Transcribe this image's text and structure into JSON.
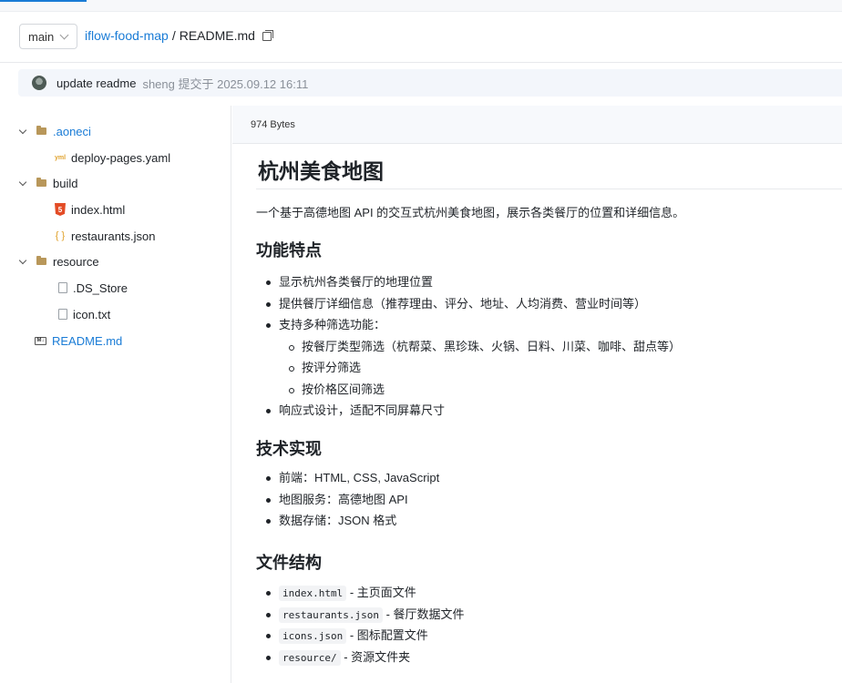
{
  "header": {
    "branch": "main",
    "repo": "iflow-food-map",
    "separator": "/",
    "file": "README.md"
  },
  "commit": {
    "message": "update readme",
    "meta": "sheng 提交于 2025.09.12 16:11"
  },
  "tree": {
    "aoneci": ".aoneci",
    "deploy": "deploy-pages.yaml",
    "build": "build",
    "index": "index.html",
    "restaurants": "restaurants.json",
    "resource": "resource",
    "ds_store": ".DS_Store",
    "icon_txt": "icon.txt",
    "readme": "README.md"
  },
  "file_size": "974 Bytes",
  "readme": {
    "title": "杭州美食地图",
    "intro": "一个基于高德地图 API 的交互式杭州美食地图，展示各类餐厅的位置和详细信息。",
    "features_heading": "功能特点",
    "features": [
      "显示杭州各类餐厅的地理位置",
      "提供餐厅详细信息（推荐理由、评分、地址、人均消费、营业时间等）",
      "支持多种筛选功能：",
      "按餐厅类型筛选（杭帮菜、黑珍珠、火锅、日料、川菜、咖啡、甜点等）",
      "按评分筛选",
      "按价格区间筛选",
      "响应式设计，适配不同屏幕尺寸"
    ],
    "tech_heading": "技术实现",
    "tech": [
      "前端：HTML, CSS, JavaScript",
      "地图服务：高德地图 API",
      "数据存储：JSON 格式"
    ],
    "structure_heading": "文件结构",
    "structure": [
      {
        "code": "index.html",
        "desc": " - 主页面文件"
      },
      {
        "code": "restaurants.json",
        "desc": " - 餐厅数据文件"
      },
      {
        "code": "icons.json",
        "desc": " - 图标配置文件"
      },
      {
        "code": "resource/",
        "desc": " - 资源文件夹"
      }
    ]
  }
}
